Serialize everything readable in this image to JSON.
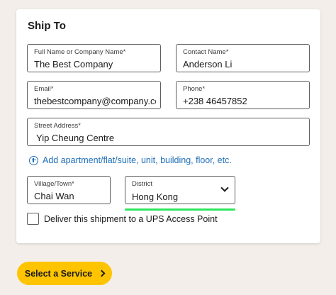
{
  "ship_to": {
    "title": "Ship To",
    "full_name": {
      "label": "Full Name or Company Name*",
      "value": "The Best Company"
    },
    "contact_name": {
      "label": "Contact Name*",
      "value": "Anderson Li"
    },
    "email": {
      "label": "Email*",
      "value": "thebestcompany@company.com"
    },
    "phone": {
      "label": "Phone*",
      "value": "+238 46457852"
    },
    "street_address": {
      "label": "Street Address*",
      "value": "Yip Cheung Centre"
    },
    "add_apartment_link": "Add apartment/flat/suite, unit, building, floor, etc.",
    "village_town": {
      "label": "Village/Town*",
      "value": "Chai Wan"
    },
    "district": {
      "label": "District",
      "value": "Hong Kong"
    },
    "access_point_checkbox": {
      "label": "Deliver this shipment to a UPS Access Point",
      "checked": false
    }
  },
  "actions": {
    "select_service_label": "Select a Service"
  },
  "colors": {
    "button_bg": "#ffc400",
    "link": "#1f6fb8",
    "focus_indicator": "#2ee65c",
    "page_bg": "#f3eee9"
  },
  "icons": {
    "add": "plus-circle-icon",
    "dropdown": "chevron-down-icon",
    "button_arrow": "chevron-right-icon"
  }
}
